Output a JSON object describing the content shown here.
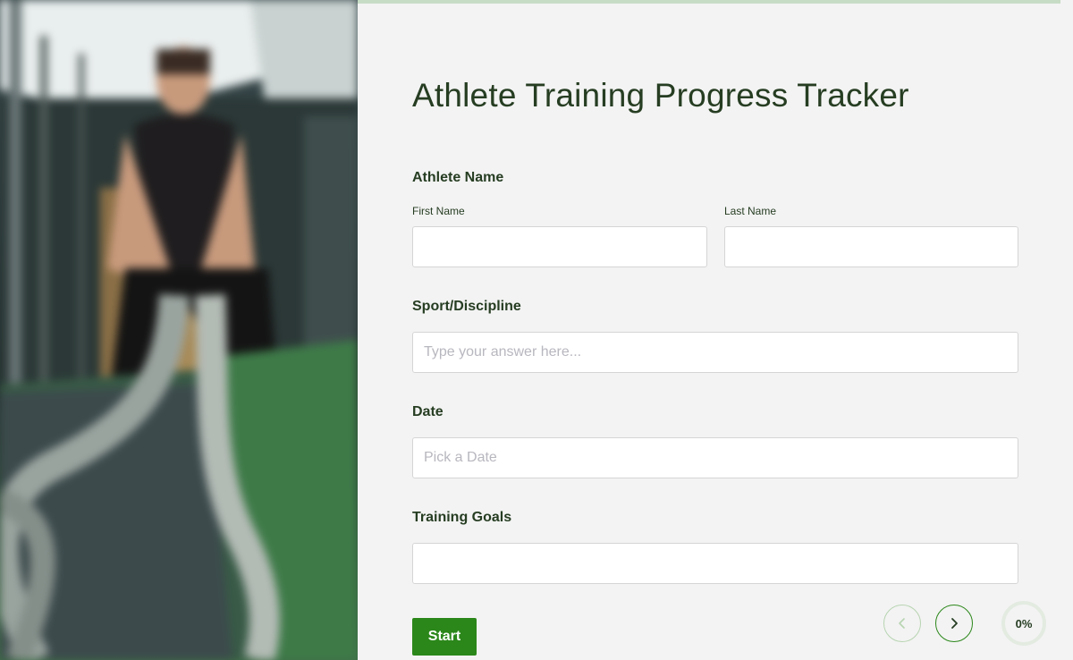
{
  "form": {
    "title": "Athlete Training Progress Tracker",
    "athlete_name": {
      "label": "Athlete Name",
      "first_name_label": "First Name",
      "first_name_value": "",
      "last_name_label": "Last Name",
      "last_name_value": ""
    },
    "sport": {
      "label": "Sport/Discipline",
      "placeholder": "Type your answer here...",
      "value": ""
    },
    "date": {
      "label": "Date",
      "placeholder": "Pick a Date",
      "value": ""
    },
    "goals": {
      "label": "Training Goals",
      "value": ""
    },
    "start_label": "Start"
  },
  "navigation": {
    "prev_icon": "chevron-left-icon",
    "next_icon": "chevron-right-icon"
  },
  "progress": {
    "label": "0%",
    "value": 0
  },
  "colors": {
    "accent": "#2b871a",
    "heading": "#263d22",
    "background": "#f3f3f3",
    "top_bar": "#c7dcc5"
  }
}
